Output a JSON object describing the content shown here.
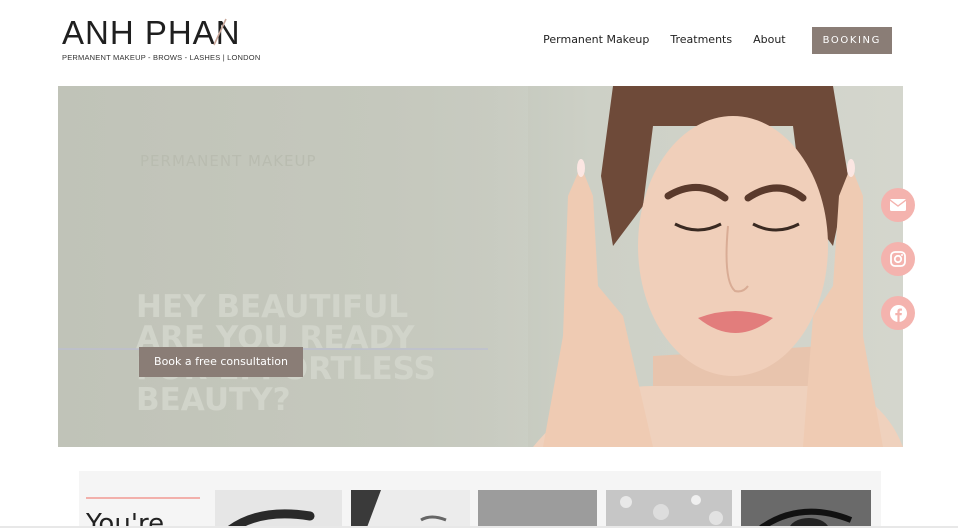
{
  "logo": {
    "title": "ANH PHAN",
    "tagline": "PERMANENT MAKEUP - BROWS - LASHES | LONDON",
    "accent_color": "#c9a79a"
  },
  "nav": {
    "links": [
      "Permanent Makeup",
      "Treatments",
      "About"
    ],
    "booking_label": "BOOKING"
  },
  "hero": {
    "overline": "PERMANENT MAKEUP",
    "headline": [
      "HEY BEAUTIFUL",
      "ARE YOU READY",
      "FOR EFFORTLESS",
      "BEAUTY?"
    ],
    "cta_label": "Book a free consultation"
  },
  "social": {
    "icons": [
      "envelope-icon",
      "instagram-icon",
      "facebook-icon"
    ],
    "color": "#f4b3ae"
  },
  "lower": {
    "title": "You're"
  },
  "colors": {
    "accent": "#8a7d76",
    "pink": "#f4b3ae"
  }
}
